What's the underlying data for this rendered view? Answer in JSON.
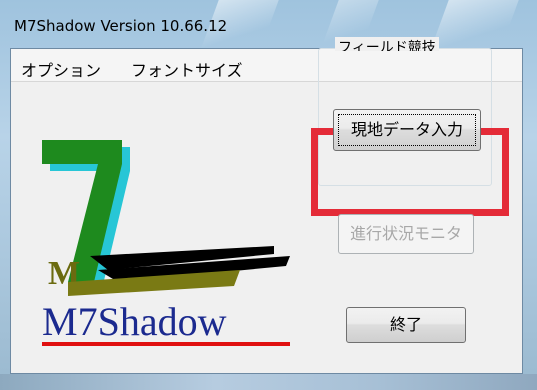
{
  "window": {
    "title": "M7Shadow Version 10.66.12"
  },
  "menubar": {
    "items": [
      {
        "label": "オプション"
      },
      {
        "label": "フォントサイズ"
      }
    ]
  },
  "logo": {
    "big_numeral": "7",
    "small_letter": "M",
    "wordmark": "M7Shadow"
  },
  "field_group": {
    "legend": "フィールド競技",
    "genchi_button": "現地データ入力",
    "shinko_button": "進行状況モニタ"
  },
  "exit_button": "終了",
  "colors": {
    "highlight": "#e42b38",
    "logo_green": "#1e8a1e",
    "logo_cyan": "#27c6d6",
    "wordmark_blue": "#1b2a8f",
    "wordmark_underline": "#e01010"
  }
}
